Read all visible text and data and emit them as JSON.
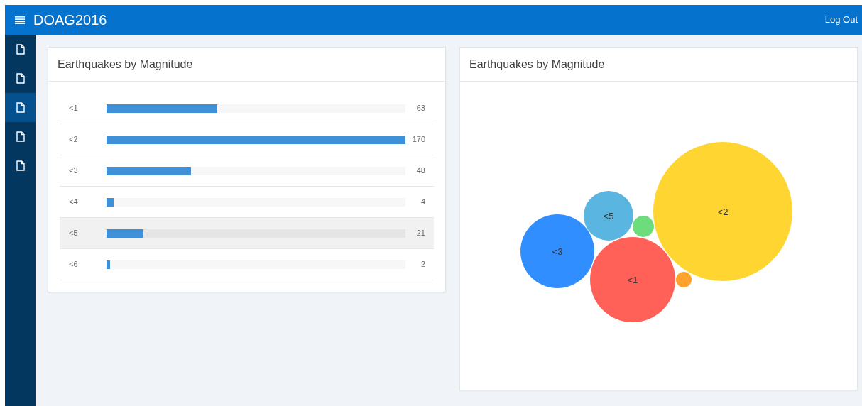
{
  "header": {
    "app_title": "DOAG2016",
    "logout": "Log Out"
  },
  "sidebar": {
    "items": [
      {
        "selected": false
      },
      {
        "selected": false
      },
      {
        "selected": true
      },
      {
        "selected": false
      },
      {
        "selected": false
      }
    ]
  },
  "bar_panel": {
    "title": "Earthquakes by Magnitude",
    "rows": [
      {
        "label": "<1",
        "level": 0.371,
        "value": "63",
        "highlighted": false
      },
      {
        "label": "<2",
        "level": 1,
        "value": "170",
        "highlighted": false
      },
      {
        "label": "<3",
        "level": 0.282,
        "value": "48",
        "highlighted": false
      },
      {
        "label": "<4",
        "level": 0.024,
        "value": "4",
        "highlighted": false
      },
      {
        "label": "<5",
        "level": 0.124,
        "value": "21",
        "highlighted": true
      },
      {
        "label": "<6",
        "level": 0.012,
        "value": "2",
        "highlighted": false
      }
    ]
  },
  "bubble_panel": {
    "title": "Earthquakes by Magnitude",
    "bubbles": [
      {
        "label": "<1",
        "color": "#ff6159"
      },
      {
        "label": "<2",
        "color": "#ffd531"
      },
      {
        "label": "<3",
        "color": "#318eff"
      },
      {
        "color": "#6cdc7c"
      },
      {
        "label": "<5",
        "color": "#5ab6e0"
      },
      {
        "color": "#ffa32c"
      }
    ]
  }
}
